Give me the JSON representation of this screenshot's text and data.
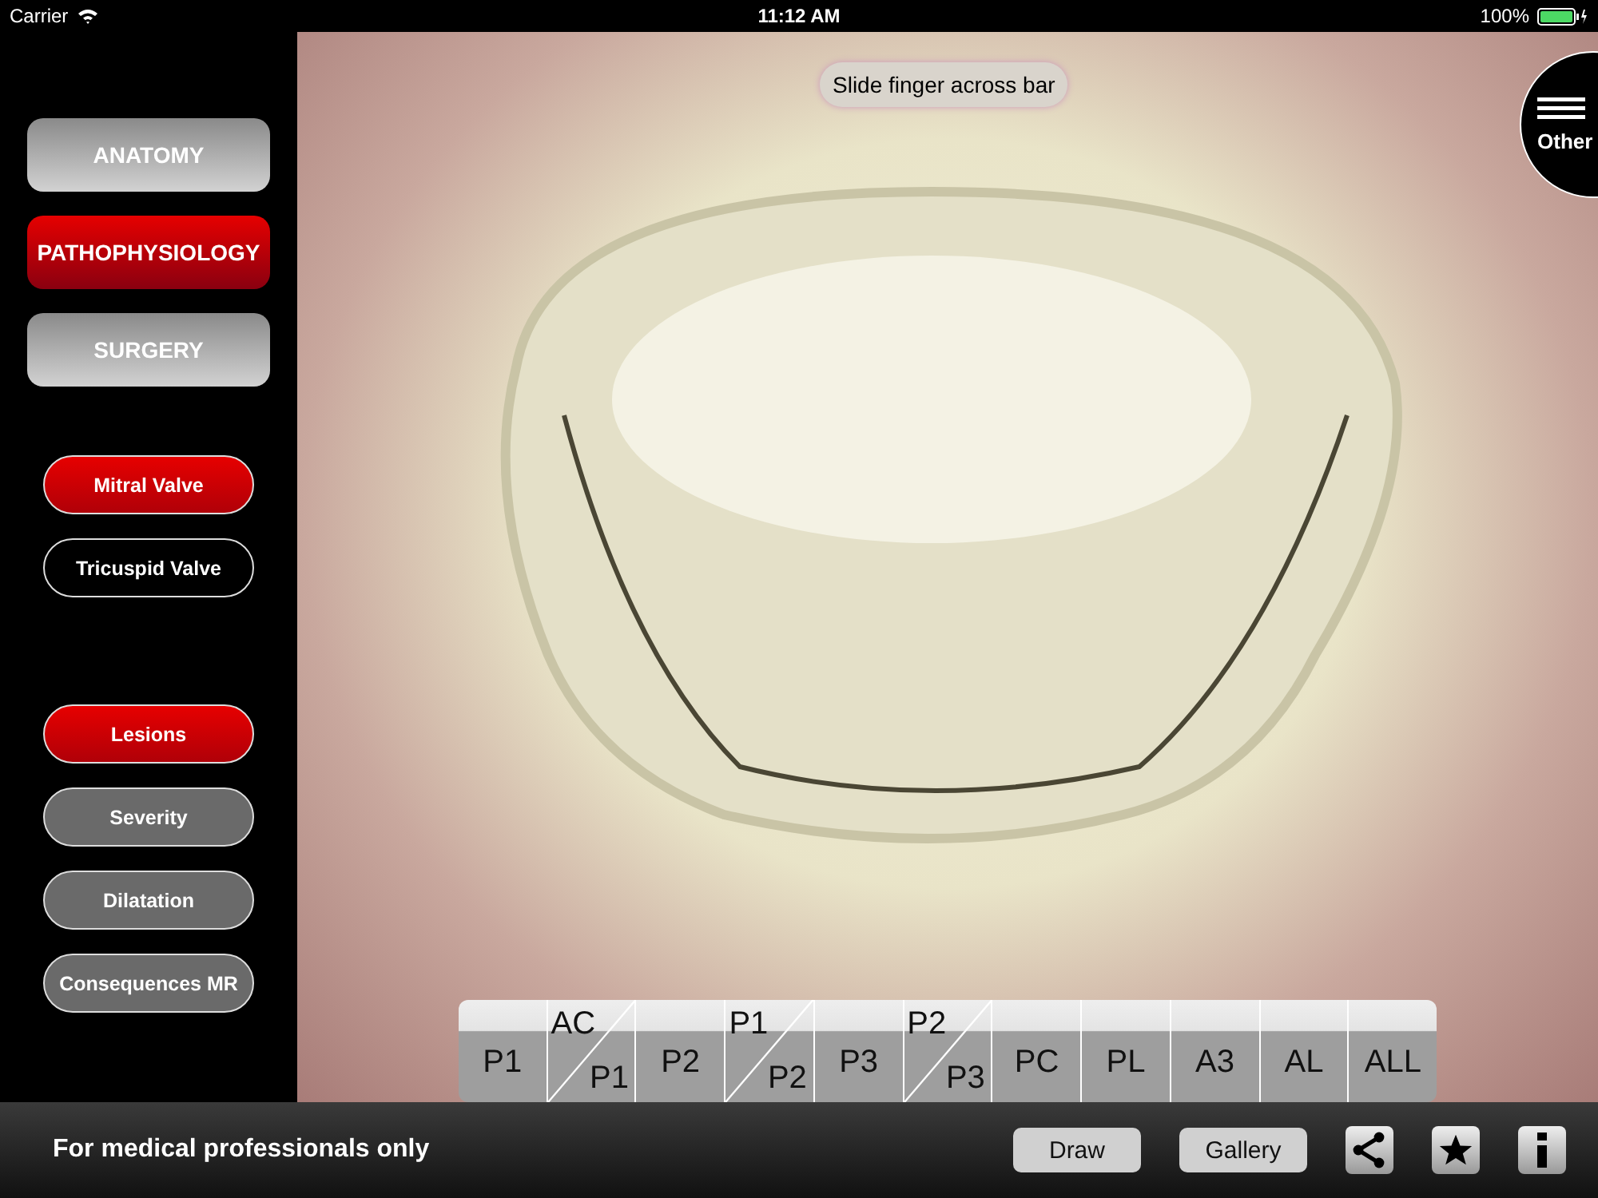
{
  "status_bar": {
    "carrier": "Carrier",
    "time": "11:12 AM",
    "battery": "100%"
  },
  "sections": [
    {
      "label": "ANATOMY",
      "selected": false
    },
    {
      "label": "PATHOPHYSIOLOGY",
      "selected": true
    },
    {
      "label": "SURGERY",
      "selected": false
    }
  ],
  "valves": [
    {
      "label": "Mitral Valve",
      "selected": true
    },
    {
      "label": "Tricuspid Valve",
      "selected": false
    }
  ],
  "topics": [
    {
      "label": "Lesions",
      "selected": true
    },
    {
      "label": "Severity",
      "selected": false
    },
    {
      "label": "Dilatation",
      "selected": false
    },
    {
      "label": "Consequences MR",
      "selected": false
    }
  ],
  "hint": "Slide finger across bar",
  "other_button": "Other",
  "segments": [
    {
      "kind": "single",
      "label": "P1"
    },
    {
      "kind": "split",
      "top": "AC",
      "bottom": "P1"
    },
    {
      "kind": "single",
      "label": "P2"
    },
    {
      "kind": "split",
      "top": "P1",
      "bottom": "P2"
    },
    {
      "kind": "single",
      "label": "P3"
    },
    {
      "kind": "split",
      "top": "P2",
      "bottom": "P3"
    },
    {
      "kind": "single",
      "label": "PC"
    },
    {
      "kind": "single",
      "label": "PL"
    },
    {
      "kind": "single",
      "label": "A3"
    },
    {
      "kind": "single",
      "label": "AL"
    },
    {
      "kind": "single",
      "label": "ALL"
    }
  ],
  "footer": {
    "notice": "For medical professionals only",
    "buttons": [
      "Draw",
      "Gallery"
    ]
  }
}
